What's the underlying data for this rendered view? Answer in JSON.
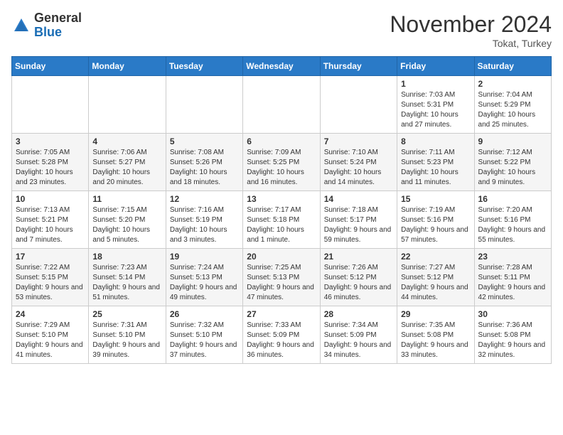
{
  "header": {
    "logo_line1": "General",
    "logo_line2": "Blue",
    "month": "November 2024",
    "location": "Tokat, Turkey"
  },
  "weekdays": [
    "Sunday",
    "Monday",
    "Tuesday",
    "Wednesday",
    "Thursday",
    "Friday",
    "Saturday"
  ],
  "weeks": [
    [
      {
        "day": "",
        "info": ""
      },
      {
        "day": "",
        "info": ""
      },
      {
        "day": "",
        "info": ""
      },
      {
        "day": "",
        "info": ""
      },
      {
        "day": "",
        "info": ""
      },
      {
        "day": "1",
        "info": "Sunrise: 7:03 AM\nSunset: 5:31 PM\nDaylight: 10 hours and 27 minutes."
      },
      {
        "day": "2",
        "info": "Sunrise: 7:04 AM\nSunset: 5:29 PM\nDaylight: 10 hours and 25 minutes."
      }
    ],
    [
      {
        "day": "3",
        "info": "Sunrise: 7:05 AM\nSunset: 5:28 PM\nDaylight: 10 hours and 23 minutes."
      },
      {
        "day": "4",
        "info": "Sunrise: 7:06 AM\nSunset: 5:27 PM\nDaylight: 10 hours and 20 minutes."
      },
      {
        "day": "5",
        "info": "Sunrise: 7:08 AM\nSunset: 5:26 PM\nDaylight: 10 hours and 18 minutes."
      },
      {
        "day": "6",
        "info": "Sunrise: 7:09 AM\nSunset: 5:25 PM\nDaylight: 10 hours and 16 minutes."
      },
      {
        "day": "7",
        "info": "Sunrise: 7:10 AM\nSunset: 5:24 PM\nDaylight: 10 hours and 14 minutes."
      },
      {
        "day": "8",
        "info": "Sunrise: 7:11 AM\nSunset: 5:23 PM\nDaylight: 10 hours and 11 minutes."
      },
      {
        "day": "9",
        "info": "Sunrise: 7:12 AM\nSunset: 5:22 PM\nDaylight: 10 hours and 9 minutes."
      }
    ],
    [
      {
        "day": "10",
        "info": "Sunrise: 7:13 AM\nSunset: 5:21 PM\nDaylight: 10 hours and 7 minutes."
      },
      {
        "day": "11",
        "info": "Sunrise: 7:15 AM\nSunset: 5:20 PM\nDaylight: 10 hours and 5 minutes."
      },
      {
        "day": "12",
        "info": "Sunrise: 7:16 AM\nSunset: 5:19 PM\nDaylight: 10 hours and 3 minutes."
      },
      {
        "day": "13",
        "info": "Sunrise: 7:17 AM\nSunset: 5:18 PM\nDaylight: 10 hours and 1 minute."
      },
      {
        "day": "14",
        "info": "Sunrise: 7:18 AM\nSunset: 5:17 PM\nDaylight: 9 hours and 59 minutes."
      },
      {
        "day": "15",
        "info": "Sunrise: 7:19 AM\nSunset: 5:16 PM\nDaylight: 9 hours and 57 minutes."
      },
      {
        "day": "16",
        "info": "Sunrise: 7:20 AM\nSunset: 5:16 PM\nDaylight: 9 hours and 55 minutes."
      }
    ],
    [
      {
        "day": "17",
        "info": "Sunrise: 7:22 AM\nSunset: 5:15 PM\nDaylight: 9 hours and 53 minutes."
      },
      {
        "day": "18",
        "info": "Sunrise: 7:23 AM\nSunset: 5:14 PM\nDaylight: 9 hours and 51 minutes."
      },
      {
        "day": "19",
        "info": "Sunrise: 7:24 AM\nSunset: 5:13 PM\nDaylight: 9 hours and 49 minutes."
      },
      {
        "day": "20",
        "info": "Sunrise: 7:25 AM\nSunset: 5:13 PM\nDaylight: 9 hours and 47 minutes."
      },
      {
        "day": "21",
        "info": "Sunrise: 7:26 AM\nSunset: 5:12 PM\nDaylight: 9 hours and 46 minutes."
      },
      {
        "day": "22",
        "info": "Sunrise: 7:27 AM\nSunset: 5:12 PM\nDaylight: 9 hours and 44 minutes."
      },
      {
        "day": "23",
        "info": "Sunrise: 7:28 AM\nSunset: 5:11 PM\nDaylight: 9 hours and 42 minutes."
      }
    ],
    [
      {
        "day": "24",
        "info": "Sunrise: 7:29 AM\nSunset: 5:10 PM\nDaylight: 9 hours and 41 minutes."
      },
      {
        "day": "25",
        "info": "Sunrise: 7:31 AM\nSunset: 5:10 PM\nDaylight: 9 hours and 39 minutes."
      },
      {
        "day": "26",
        "info": "Sunrise: 7:32 AM\nSunset: 5:10 PM\nDaylight: 9 hours and 37 minutes."
      },
      {
        "day": "27",
        "info": "Sunrise: 7:33 AM\nSunset: 5:09 PM\nDaylight: 9 hours and 36 minutes."
      },
      {
        "day": "28",
        "info": "Sunrise: 7:34 AM\nSunset: 5:09 PM\nDaylight: 9 hours and 34 minutes."
      },
      {
        "day": "29",
        "info": "Sunrise: 7:35 AM\nSunset: 5:08 PM\nDaylight: 9 hours and 33 minutes."
      },
      {
        "day": "30",
        "info": "Sunrise: 7:36 AM\nSunset: 5:08 PM\nDaylight: 9 hours and 32 minutes."
      }
    ]
  ]
}
